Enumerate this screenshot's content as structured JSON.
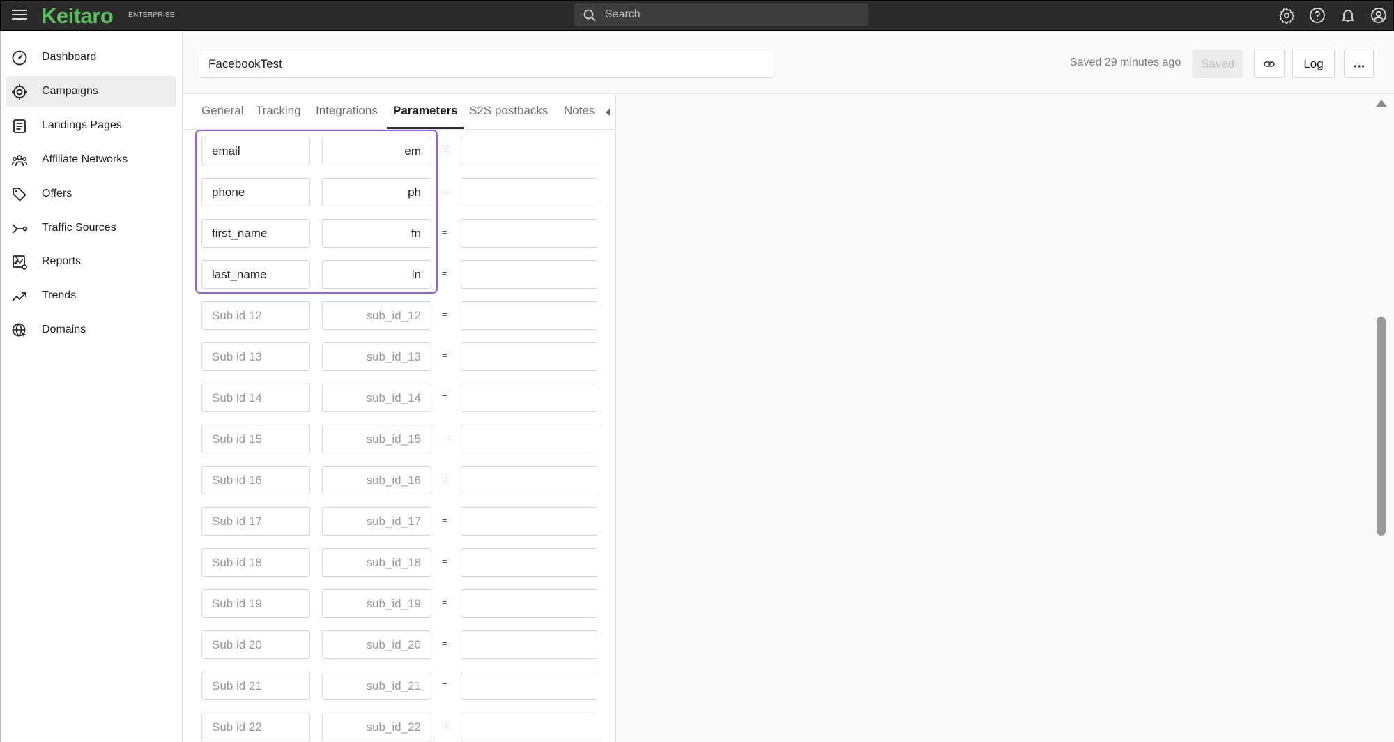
{
  "brand": {
    "name": "Keitaro",
    "edition": "ENTERPRISE",
    "color": "#5bc15f"
  },
  "search": {
    "placeholder": "Search"
  },
  "topbar_icons": [
    "gear-icon",
    "help-icon",
    "bell-icon",
    "user-icon"
  ],
  "sidebar": {
    "items": [
      {
        "label": "Dashboard",
        "icon": "dashboard-icon",
        "active": false
      },
      {
        "label": "Campaigns",
        "icon": "target-icon",
        "active": true
      },
      {
        "label": "Landings Pages",
        "icon": "page-icon",
        "active": false
      },
      {
        "label": "Affiliate Networks",
        "icon": "users-icon",
        "active": false
      },
      {
        "label": "Offers",
        "icon": "tag-icon",
        "active": false
      },
      {
        "label": "Traffic Sources",
        "icon": "route-icon",
        "active": false
      },
      {
        "label": "Reports",
        "icon": "chart-icon",
        "active": false,
        "has_submenu": true
      },
      {
        "label": "Trends",
        "icon": "trend-icon",
        "active": false
      },
      {
        "label": "Domains",
        "icon": "globe-icon",
        "active": false
      }
    ]
  },
  "header": {
    "campaign_name": "FacebookTest",
    "saved_status": "Saved 29 minutes ago",
    "saved_button": "Saved",
    "log_button": "Log"
  },
  "tabs": [
    {
      "label": "General",
      "active": false
    },
    {
      "label": "Tracking",
      "active": false
    },
    {
      "label": "Integrations",
      "active": false
    },
    {
      "label": "Parameters",
      "active": true
    },
    {
      "label": "S2S postbacks",
      "active": false
    },
    {
      "label": "Notes",
      "active": false
    }
  ],
  "parameters": {
    "highlighted_rows": 4,
    "highlight_color": "#9b5de5",
    "rows": [
      {
        "name": "email",
        "name_placeholder": "",
        "param": "em",
        "param_placeholder": "",
        "value": ""
      },
      {
        "name": "phone",
        "name_placeholder": "",
        "param": "ph",
        "param_placeholder": "",
        "value": ""
      },
      {
        "name": "first_name",
        "name_placeholder": "",
        "param": "fn",
        "param_placeholder": "",
        "value": ""
      },
      {
        "name": "last_name",
        "name_placeholder": "",
        "param": "ln",
        "param_placeholder": "",
        "value": ""
      },
      {
        "name": "",
        "name_placeholder": "Sub id 12",
        "param": "",
        "param_placeholder": "sub_id_12",
        "value": ""
      },
      {
        "name": "",
        "name_placeholder": "Sub id 13",
        "param": "",
        "param_placeholder": "sub_id_13",
        "value": ""
      },
      {
        "name": "",
        "name_placeholder": "Sub id 14",
        "param": "",
        "param_placeholder": "sub_id_14",
        "value": ""
      },
      {
        "name": "",
        "name_placeholder": "Sub id 15",
        "param": "",
        "param_placeholder": "sub_id_15",
        "value": ""
      },
      {
        "name": "",
        "name_placeholder": "Sub id 16",
        "param": "",
        "param_placeholder": "sub_id_16",
        "value": ""
      },
      {
        "name": "",
        "name_placeholder": "Sub id 17",
        "param": "",
        "param_placeholder": "sub_id_17",
        "value": ""
      },
      {
        "name": "",
        "name_placeholder": "Sub id 18",
        "param": "",
        "param_placeholder": "sub_id_18",
        "value": ""
      },
      {
        "name": "",
        "name_placeholder": "Sub id 19",
        "param": "",
        "param_placeholder": "sub_id_19",
        "value": ""
      },
      {
        "name": "",
        "name_placeholder": "Sub id 20",
        "param": "",
        "param_placeholder": "sub_id_20",
        "value": ""
      },
      {
        "name": "",
        "name_placeholder": "Sub id 21",
        "param": "",
        "param_placeholder": "sub_id_21",
        "value": ""
      },
      {
        "name": "",
        "name_placeholder": "Sub id 22",
        "param": "",
        "param_placeholder": "sub_id_22",
        "value": ""
      }
    ]
  }
}
